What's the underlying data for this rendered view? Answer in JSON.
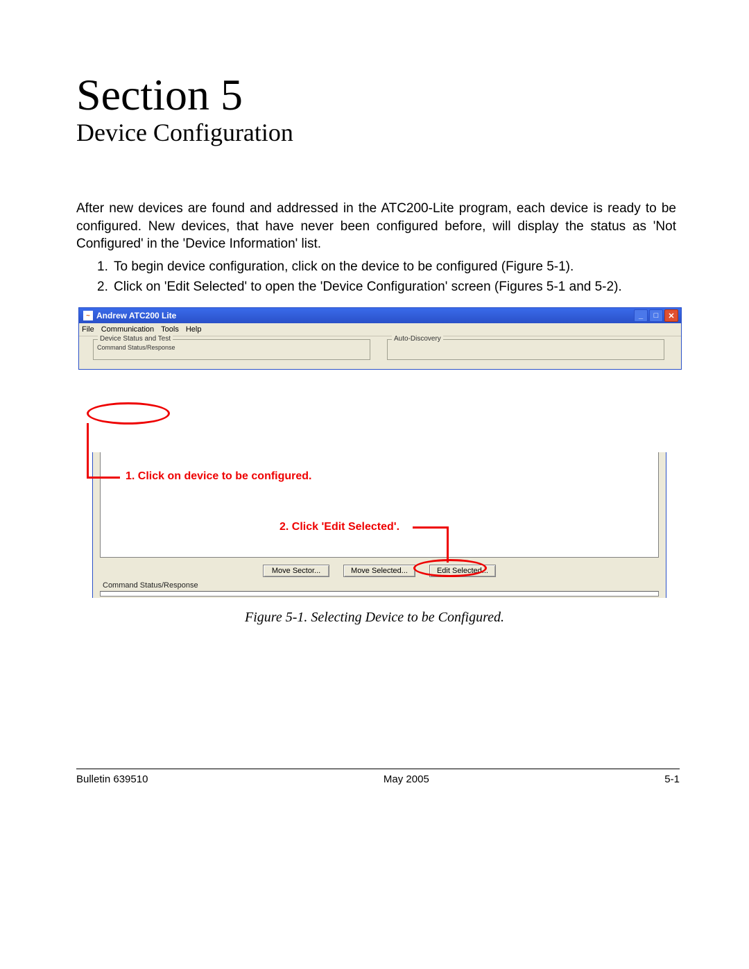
{
  "heading": {
    "section": "Section 5",
    "subtitle": "Device Configuration"
  },
  "intro": "After new devices are found and addressed in the ATC200-Lite program, each device is ready to be configured. New devices, that have never been configured before, will display the status as 'Not Configured' in the 'Device Information' list.",
  "steps": [
    "To begin device configuration, click on the device to be configured (Figure 5-1).",
    "Click on 'Edit Selected' to open the 'Device Configuration' screen (Figures 5-1 and 5-2)."
  ],
  "app": {
    "title": "Andrew ATC200 Lite",
    "menus": [
      "File",
      "Communication",
      "Tools",
      "Help"
    ],
    "group_left": "Device Status and Test",
    "group_left_sub": "Command Status/Response",
    "group_right": "Auto-Discovery",
    "buttons": {
      "move_sector": "Move Sector...",
      "move_selected": "Move Selected...",
      "edit_selected": "Edit Selected..."
    },
    "cmd_label": "Command Status/Response"
  },
  "annotations": {
    "step1": "1. Click on device to be configured.",
    "step2": "2. Click 'Edit Selected'."
  },
  "caption": "Figure 5-1. Selecting Device to be Configured.",
  "footer": {
    "left": "Bulletin 639510",
    "center": "May 2005",
    "right": "5-1"
  }
}
